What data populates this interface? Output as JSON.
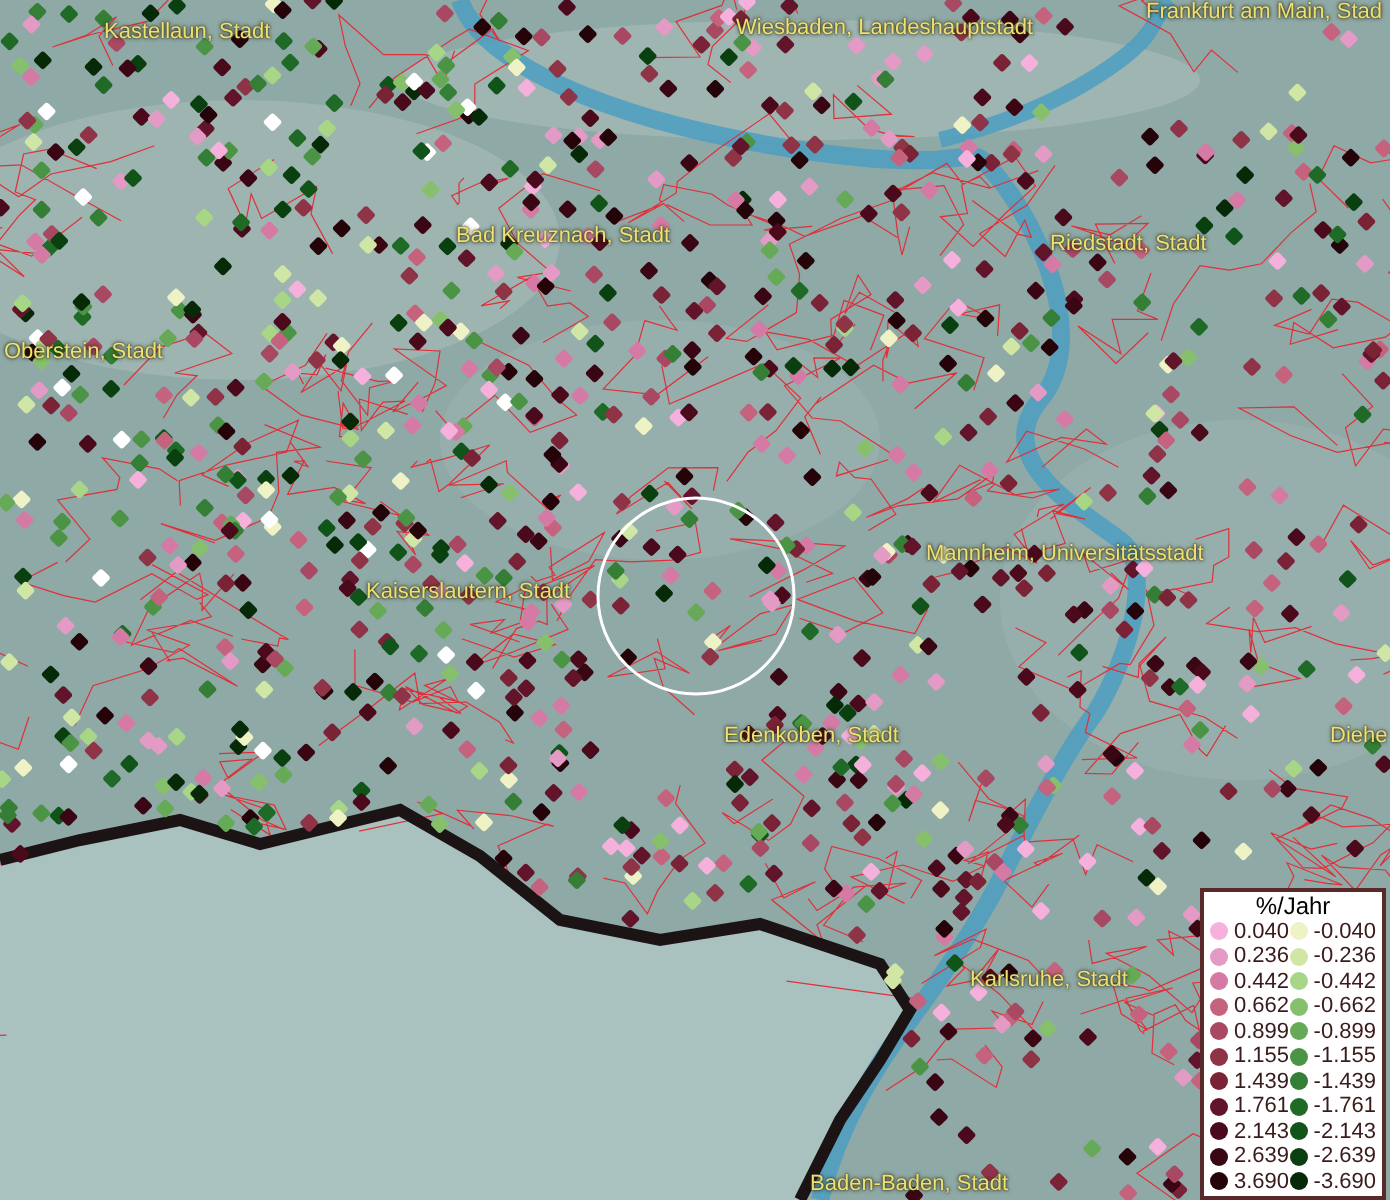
{
  "map": {
    "cities": [
      {
        "name": "Frankfurt am Main, Stad"
      },
      {
        "name": "Kastellaun, Stadt"
      },
      {
        "name": "Wiesbaden, Landeshauptstadt"
      },
      {
        "name": "Bad Kreuznach, Stadt"
      },
      {
        "name": "Riedstadt, Stadt"
      },
      {
        "name": "Oberstein, Stadt"
      },
      {
        "name": "Mannheim, Universitätsstadt"
      },
      {
        "name": "Kaiserslautern, Stadt"
      },
      {
        "name": "Edenkoben, Stadt"
      },
      {
        "name": "Diehe"
      },
      {
        "name": "Karlsruhe, Stadt"
      },
      {
        "name": "Baden-Baden, Stadt"
      }
    ]
  },
  "legend": {
    "title": "%/Jahr",
    "positive": [
      {
        "label": "0.040",
        "color": "#f5b0dc"
      },
      {
        "label": "0.236",
        "color": "#e39ac4"
      },
      {
        "label": "0.442",
        "color": "#d57aa4"
      },
      {
        "label": "0.662",
        "color": "#c5637f"
      },
      {
        "label": "0.899",
        "color": "#a84862"
      },
      {
        "label": "1.155",
        "color": "#8f3347"
      },
      {
        "label": "1.439",
        "color": "#7a2236"
      },
      {
        "label": "1.761",
        "color": "#62142a"
      },
      {
        "label": "2.143",
        "color": "#4a0a1c"
      },
      {
        "label": "2.639",
        "color": "#3a0614"
      },
      {
        "label": "3.690",
        "color": "#240309"
      }
    ],
    "negative": [
      {
        "label": "-0.040",
        "color": "#eef2c4"
      },
      {
        "label": "-0.236",
        "color": "#cfe6a4"
      },
      {
        "label": "-0.442",
        "color": "#a6d686"
      },
      {
        "label": "-0.662",
        "color": "#86c06c"
      },
      {
        "label": "-0.899",
        "color": "#66a957"
      },
      {
        "label": "-1.155",
        "color": "#4c9445"
      },
      {
        "label": "-1.439",
        "color": "#347e35"
      },
      {
        "label": "-1.761",
        "color": "#1f6a27"
      },
      {
        "label": "-2.143",
        "color": "#10541a"
      },
      {
        "label": "-2.639",
        "color": "#0a4010"
      },
      {
        "label": "-3.690",
        "color": "#062a08"
      }
    ]
  }
}
